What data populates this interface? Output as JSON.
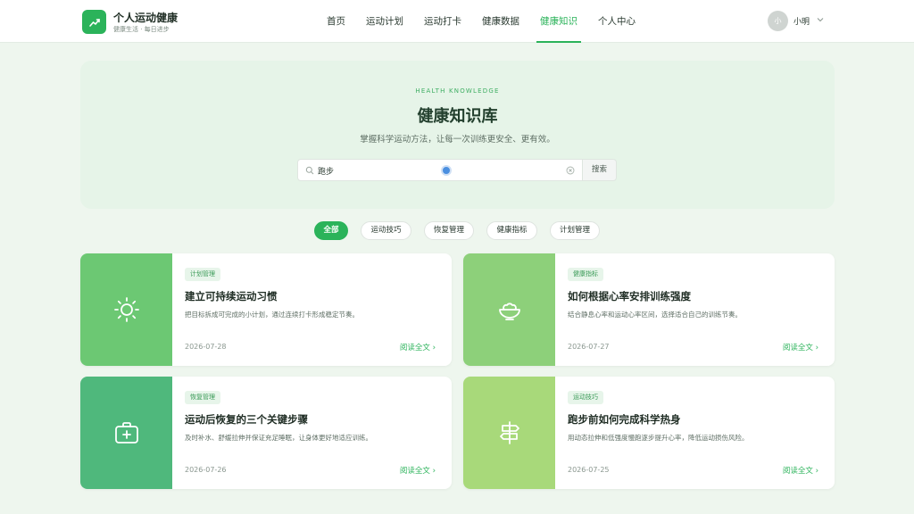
{
  "brand": {
    "title": "个人运动健康",
    "subtitle": "健康生活 · 每日进步"
  },
  "nav": [
    {
      "label": "首页",
      "active": false
    },
    {
      "label": "运动计划",
      "active": false
    },
    {
      "label": "运动打卡",
      "active": false
    },
    {
      "label": "健康数据",
      "active": false
    },
    {
      "label": "健康知识",
      "active": true
    },
    {
      "label": "个人中心",
      "active": false
    }
  ],
  "user": {
    "avatar_text": "小",
    "name": "小明"
  },
  "hero": {
    "eyebrow": "HEALTH KNOWLEDGE",
    "title": "健康知识库",
    "description": "掌握科学运动方法，让每一次训练更安全、更有效。"
  },
  "search": {
    "value": "跑步",
    "button_label": "搜索"
  },
  "filters": [
    {
      "label": "全部",
      "active": true
    },
    {
      "label": "运动技巧",
      "active": false
    },
    {
      "label": "恢复管理",
      "active": false
    },
    {
      "label": "健康指标",
      "active": false
    },
    {
      "label": "计划管理",
      "active": false
    }
  ],
  "articles": [
    {
      "tag": "计划管理",
      "title": "建立可持续运动习惯",
      "desc": "把目标拆成可完成的小计划，通过连续打卡形成稳定节奏。",
      "date": "2026-07-28",
      "read_label": "阅读全文",
      "icon": "sun-icon",
      "color": "#6cc873"
    },
    {
      "tag": "健康指标",
      "title": "如何根据心率安排训练强度",
      "desc": "结合静息心率和运动心率区间，选择适合自己的训练节奏。",
      "date": "2026-07-27",
      "read_label": "阅读全文",
      "icon": "bowl-icon",
      "color": "#8dd07a"
    },
    {
      "tag": "恢复管理",
      "title": "运动后恢复的三个关键步骤",
      "desc": "及时补水、舒缓拉伸并保证充足睡眠，让身体更好地适应训练。",
      "date": "2026-07-26",
      "read_label": "阅读全文",
      "icon": "first-aid-kit-icon",
      "color": "#4fb87c"
    },
    {
      "tag": "运动技巧",
      "title": "跑步前如何完成科学热身",
      "desc": "用动态拉伸和低强度慢跑逐步提升心率，降低运动损伤风险。",
      "date": "2026-07-25",
      "read_label": "阅读全文",
      "icon": "signpost-icon",
      "color": "#a8d97a"
    }
  ],
  "colors": {
    "accent": "#2bb35a",
    "hero_bg": "#e6f4e8",
    "page_bg": "#eef6ee"
  }
}
